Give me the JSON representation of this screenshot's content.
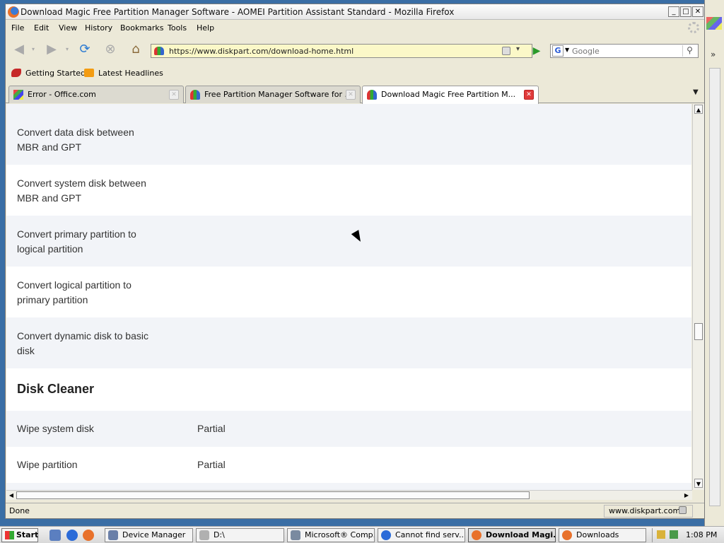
{
  "window": {
    "title": "Download Magic Free Partition Manager Software - AOMEI Partition Assistant Standard - Mozilla Firefox"
  },
  "menu": [
    "File",
    "Edit",
    "View",
    "History",
    "Bookmarks",
    "Tools",
    "Help"
  ],
  "nav": {
    "url": "https://www.diskpart.com/download-home.html",
    "search_placeholder": "Google"
  },
  "bookmarks": [
    {
      "label": "Getting Started",
      "icon": "getting-started-icon"
    },
    {
      "label": "Latest Headlines",
      "icon": "rss-icon"
    }
  ],
  "tabs": [
    {
      "label": "Error - Office.com",
      "active": false
    },
    {
      "label": "Free Partition Manager Software for ...",
      "active": false
    },
    {
      "label": "Download Magic Free Partition M...",
      "active": true
    }
  ],
  "content": {
    "rows": [
      {
        "feature": "Convert data disk between MBR and GPT",
        "value": ""
      },
      {
        "feature": "Convert system disk between MBR and GPT",
        "value": ""
      },
      {
        "feature": "Convert primary partition to logical partition",
        "value": ""
      },
      {
        "feature": "Convert logical partition to primary partition",
        "value": ""
      },
      {
        "feature": "Convert dynamic disk to basic disk",
        "value": ""
      }
    ],
    "section_title": "Disk Cleaner",
    "cleaner_rows": [
      {
        "feature": "Wipe system disk",
        "value": "Partial"
      },
      {
        "feature": "Wipe partition",
        "value": "Partial"
      }
    ]
  },
  "status": {
    "text": "Done",
    "domain": "www.diskpart.com"
  },
  "taskbar": {
    "start_label": "Start",
    "tasks": [
      {
        "label": "Device Manager",
        "active": false
      },
      {
        "label": "D:\\",
        "active": false
      },
      {
        "label": "Microsoft® Comp...",
        "active": false
      },
      {
        "label": "Cannot find serv...",
        "active": false
      },
      {
        "label": "Download Magi...",
        "active": true
      },
      {
        "label": "Downloads",
        "active": false
      }
    ],
    "clock": "1:08 PM"
  },
  "colors": {
    "row_shade": "#f2f4f8",
    "active_tab_close": "#e03b3b",
    "url_bg": "#fbf8c8"
  }
}
